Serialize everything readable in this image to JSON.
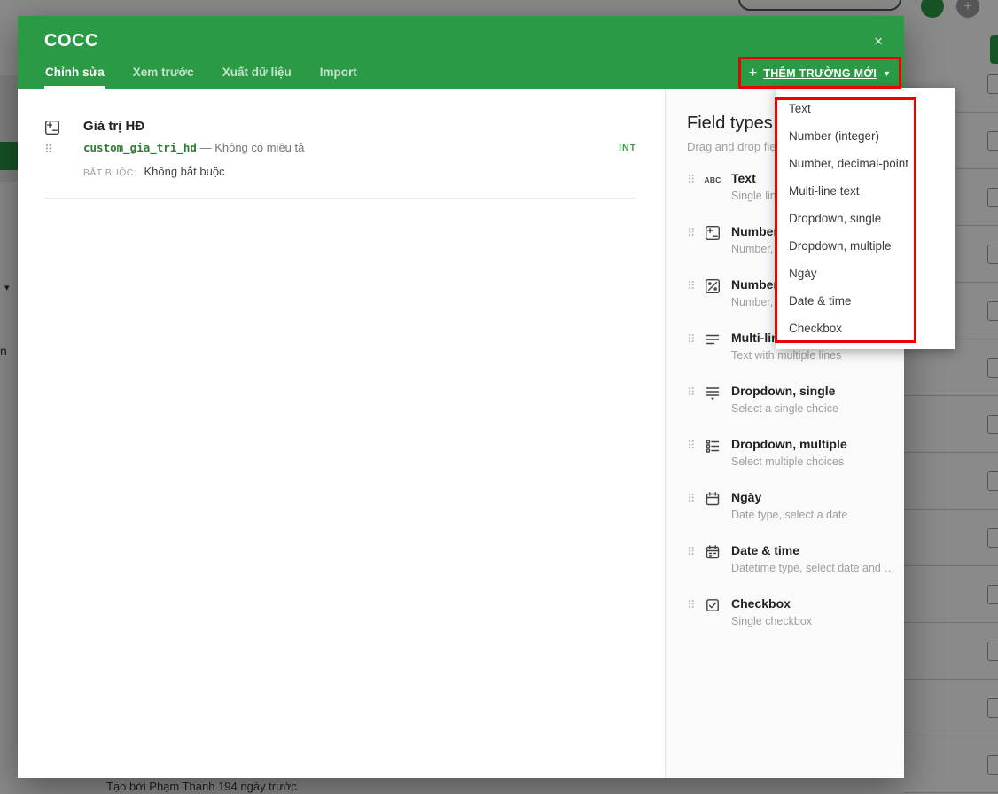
{
  "colors": {
    "brand_green": "#2a9a45",
    "annotation_red": "#ee0000",
    "code_green": "#2e7d32",
    "badge_green": "#43a047"
  },
  "icons": {
    "close": "×",
    "plus": "+",
    "caret_down": "▼",
    "drag_handle": "⠿",
    "abc": "ABC",
    "sidebar_caret": "▾",
    "bg_plus": "+"
  },
  "background": {
    "created_by": "Tạo bởi Phạm Thanh 194 ngày trước",
    "sidebar_fragment": "n"
  },
  "modal": {
    "title": "COCC",
    "tabs": [
      {
        "label": "Chỉnh sửa"
      },
      {
        "label": "Xem trước"
      },
      {
        "label": "Xuất dữ liệu"
      },
      {
        "label": "Import"
      }
    ],
    "add_field_button": {
      "label": "THÊM TRƯỜNG MỚI"
    },
    "field": {
      "title": "Giá trị HĐ",
      "code": "custom_gia_tri_hd",
      "dash": "—",
      "description": "Không có miêu tả",
      "type_badge": "INT",
      "required_label": "BẮT BUỘC:",
      "required_value": "Không bắt buộc"
    },
    "field_types_panel": {
      "title": "Field types",
      "subtitle": "Drag and drop field types",
      "items": [
        {
          "name": "Text",
          "desc": "Single line of text"
        },
        {
          "name": "Number (integer)",
          "desc": "Number, integer"
        },
        {
          "name": "Number, decimal-point",
          "desc": "Number, decimal"
        },
        {
          "name": "Multi-line text",
          "desc": "Text with multiple lines"
        },
        {
          "name": "Dropdown, single",
          "desc": "Select a single choice"
        },
        {
          "name": "Dropdown, multiple",
          "desc": "Select multiple choices"
        },
        {
          "name": "Ngày",
          "desc": "Date type, select a date"
        },
        {
          "name": "Date & time",
          "desc": "Datetime type, select date and time"
        },
        {
          "name": "Checkbox",
          "desc": "Single checkbox"
        }
      ]
    }
  },
  "dropdown_menu": {
    "items": [
      "Text",
      "Number (integer)",
      "Number, decimal-point",
      "Multi-line text",
      "Dropdown, single",
      "Dropdown, multiple",
      "Ngày",
      "Date & time",
      "Checkbox"
    ]
  }
}
